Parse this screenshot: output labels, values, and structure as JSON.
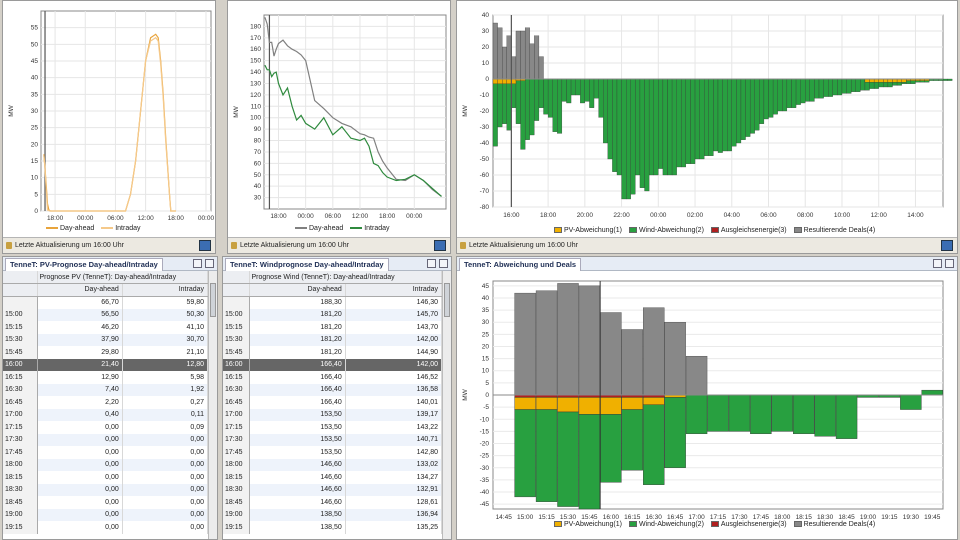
{
  "footer_text": "Letzte Aktualisierung um 16:00 Uhr",
  "colors": {
    "dayahead": "#e8a43c",
    "intraday": "#f5c98a",
    "wind_dayahead": "#808080",
    "wind_intraday": "#2f8a3e",
    "pv_dev": "#f0b000",
    "wind_dev": "#28a040",
    "balance": "#b02020",
    "deals": "#888888",
    "selection": "#666666"
  },
  "pv_chart": {
    "legend": [
      "Day-ahead",
      "Intraday"
    ],
    "chart_data": {
      "type": "line",
      "ylabel": "MW",
      "ylim": [
        0,
        60
      ],
      "yticks": [
        0,
        5,
        10,
        15,
        20,
        25,
        30,
        35,
        40,
        45,
        50,
        55
      ],
      "xticks": [
        "18:00",
        "00:00",
        "06:00",
        "12:00",
        "18:00",
        "00:00"
      ],
      "series": [
        {
          "name": "Day-ahead",
          "x": [
            15.75,
            16,
            16.25,
            16.5,
            16.75,
            17,
            17.25,
            17.5,
            18,
            24,
            30,
            32,
            33,
            34,
            35,
            36,
            37,
            38,
            38.5,
            39,
            39.5,
            40,
            40.75,
            41,
            41.25,
            41.5,
            41.75,
            42
          ],
          "values": [
            17,
            12.9,
            7.4,
            2.2,
            0.4,
            0,
            0,
            0,
            0,
            0,
            0,
            0,
            5,
            15,
            30,
            45,
            52,
            53,
            52,
            45,
            35,
            22,
            5,
            0,
            0,
            0,
            0,
            0
          ]
        },
        {
          "name": "Intraday",
          "x": [
            15.75,
            16,
            16.25,
            16.5,
            16.75,
            17,
            17.25,
            17.5,
            18,
            24,
            30,
            32,
            33,
            34,
            35,
            36,
            37,
            38,
            38.5,
            39,
            39.5,
            40,
            40.75,
            41,
            41.25,
            41.5,
            41.75,
            42
          ],
          "values": [
            17,
            12.8,
            5.98,
            0.27,
            0.11,
            0.09,
            0,
            0,
            0,
            0,
            0,
            0,
            5,
            15,
            30,
            45,
            51,
            52,
            51,
            44,
            34,
            21,
            5,
            0,
            0,
            0,
            0,
            0
          ]
        }
      ]
    }
  },
  "wind_chart": {
    "legend": [
      "Day-ahead",
      "Intraday"
    ],
    "chart_data": {
      "type": "line",
      "ylabel": "MW",
      "ylim": [
        20,
        190
      ],
      "yticks": [
        30,
        40,
        50,
        60,
        70,
        80,
        90,
        100,
        110,
        120,
        130,
        140,
        150,
        160,
        170,
        180
      ],
      "xticks": [
        "18:00",
        "00:00",
        "06:00",
        "12:00",
        "18:00",
        "00:00"
      ],
      "series": [
        {
          "name": "Day-ahead",
          "x": [
            15,
            15.5,
            16,
            16.5,
            17,
            17.5,
            18,
            19,
            20,
            21,
            22,
            23,
            24,
            26,
            28,
            30,
            32,
            34,
            36,
            37,
            38,
            39,
            40,
            41,
            42,
            44,
            46,
            48,
            50,
            52,
            54
          ],
          "values": [
            188,
            182,
            166,
            166,
            154,
            160,
            165,
            168,
            163,
            160,
            158,
            155,
            150,
            115,
            108,
            100,
            95,
            92,
            86,
            85,
            83,
            82,
            70,
            62,
            56,
            46,
            45,
            50,
            45,
            37,
            31
          ]
        },
        {
          "name": "Intraday",
          "x": [
            15,
            15.5,
            16,
            16.5,
            17,
            17.5,
            18,
            19,
            20,
            21,
            22,
            23,
            24,
            26,
            28,
            30,
            32,
            34,
            36,
            37,
            38,
            39,
            40,
            41,
            42,
            44,
            46,
            48,
            50,
            52,
            54
          ],
          "values": [
            146,
            142,
            142,
            136,
            139,
            140,
            130,
            120,
            126,
            110,
            98,
            102,
            95,
            90,
            100,
            85,
            92,
            82,
            80,
            82,
            75,
            60,
            58,
            52,
            48,
            45,
            46,
            50,
            45,
            38,
            31
          ]
        }
      ]
    }
  },
  "top_right_chart": {
    "legend": [
      "PV-Abweichung(1)",
      "Wind-Abweichung(2)",
      "Ausgleichsenergie(3)",
      "Resultierende Deals(4)"
    ],
    "chart_data": {
      "type": "bar",
      "ylabel": "MW",
      "ylim": [
        -80,
        40
      ],
      "yticks": [
        40,
        30,
        20,
        10,
        0,
        -10,
        -20,
        -30,
        -40,
        -50,
        -60,
        -70,
        -80
      ],
      "xticks": [
        "16:00",
        "18:00",
        "20:00",
        "22:00",
        "00:00",
        "02:00",
        "04:00",
        "06:00",
        "08:00",
        "10:00",
        "12:00",
        "14:00"
      ],
      "x_start_hours": 15.0,
      "x_step_hours": 0.25,
      "series": [
        {
          "name": "Resultierende Deals(4)",
          "values": [
            35,
            32,
            20,
            27,
            14,
            30,
            30,
            32,
            22,
            27,
            14,
            0
          ]
        },
        {
          "name": "Wind-Abweichung(2)",
          "values": [
            -42,
            -30,
            -28,
            -32,
            -18,
            -28,
            -44,
            -38,
            -35,
            -26,
            -18,
            -22,
            -24,
            -33,
            -34,
            -14,
            -15,
            -10,
            -10,
            -15,
            -14,
            -18,
            -12,
            -24,
            -40,
            -50,
            -58,
            -60,
            -75,
            -75,
            -72,
            -60,
            -68,
            -70,
            -60,
            -60,
            -56,
            -60,
            -60,
            -60,
            -55,
            -55,
            -53,
            -53,
            -50,
            -50,
            -48,
            -48,
            -45,
            -46,
            -45,
            -45,
            -42,
            -40,
            -38,
            -36,
            -34,
            -32,
            -28,
            -25,
            -24,
            -22,
            -20,
            -20,
            -18,
            -18,
            -16,
            -15,
            -14,
            -14,
            -12,
            -12,
            -11,
            -11,
            -10,
            -10,
            -9,
            -9,
            -8,
            -8,
            -7,
            -7,
            -6,
            -6,
            -5,
            -5,
            -5,
            -4,
            -4,
            -3,
            -3,
            -3,
            -2,
            -2,
            -2,
            -1,
            -1,
            -1,
            -1,
            -1,
            0,
            0,
            0
          ]
        },
        {
          "name": "PV-Abweichung(1)",
          "values": [
            -3,
            -3,
            -3,
            -3,
            -3,
            -1,
            -1,
            0,
            0,
            0,
            0,
            0,
            0,
            0,
            0,
            0,
            0,
            0,
            0,
            0,
            0,
            0,
            0,
            0,
            0,
            0,
            0,
            0,
            0,
            0,
            0,
            0,
            0,
            0,
            0,
            0,
            0,
            0,
            0,
            0,
            0,
            0,
            0,
            0,
            0,
            0,
            0,
            0,
            0,
            0,
            0,
            0,
            0,
            0,
            0,
            0,
            0,
            0,
            0,
            0,
            0,
            0,
            0,
            0,
            0,
            0,
            0,
            0,
            0,
            0,
            0,
            0,
            0,
            0,
            0,
            0,
            0,
            0,
            0,
            0,
            0,
            -2,
            -2,
            -2,
            -2,
            -2,
            -2,
            -2,
            -2,
            -2,
            -1,
            -1,
            -1,
            -1,
            -1,
            0,
            0,
            0,
            0,
            0,
            0,
            0,
            0
          ]
        }
      ]
    }
  },
  "pv_table": {
    "tab": "TenneT: PV-Prognose Day-ahead/Intraday",
    "group_header": "Prognose PV (TenneT): Day-ahead/Intraday",
    "columns": [
      "Day-ahead",
      "Intraday"
    ],
    "rows": [
      {
        "time": "",
        "da": "66,70",
        "id": "59,80"
      },
      {
        "time": "15:00",
        "da": "56,50",
        "id": "50,30"
      },
      {
        "time": "15:15",
        "da": "46,20",
        "id": "41,10"
      },
      {
        "time": "15:30",
        "da": "37,90",
        "id": "30,70"
      },
      {
        "time": "15:45",
        "da": "29,80",
        "id": "21,10"
      },
      {
        "time": "16:00",
        "da": "21,40",
        "id": "12,80"
      },
      {
        "time": "16:15",
        "da": "12,90",
        "id": "5,98"
      },
      {
        "time": "16:30",
        "da": "7,40",
        "id": "1,92"
      },
      {
        "time": "16:45",
        "da": "2,20",
        "id": "0,27"
      },
      {
        "time": "17:00",
        "da": "0,40",
        "id": "0,11"
      },
      {
        "time": "17:15",
        "da": "0,00",
        "id": "0,09"
      },
      {
        "time": "17:30",
        "da": "0,00",
        "id": "0,00"
      },
      {
        "time": "17:45",
        "da": "0,00",
        "id": "0,00"
      },
      {
        "time": "18:00",
        "da": "0,00",
        "id": "0,00"
      },
      {
        "time": "18:15",
        "da": "0,00",
        "id": "0,00"
      },
      {
        "time": "18:30",
        "da": "0,00",
        "id": "0,00"
      },
      {
        "time": "18:45",
        "da": "0,00",
        "id": "0,00"
      },
      {
        "time": "19:00",
        "da": "0,00",
        "id": "0,00"
      },
      {
        "time": "19:15",
        "da": "0,00",
        "id": "0,00"
      }
    ]
  },
  "wind_table": {
    "tab": "TenneT: Windprognose Day-ahead/Intraday",
    "group_header": "Prognose Wind (TenneT): Day-ahead/Intraday",
    "columns": [
      "Day-ahead",
      "Intraday"
    ],
    "rows": [
      {
        "time": "",
        "da": "188,30",
        "id": "146,30"
      },
      {
        "time": "15:00",
        "da": "181,20",
        "id": "145,70"
      },
      {
        "time": "15:15",
        "da": "181,20",
        "id": "143,70"
      },
      {
        "time": "15:30",
        "da": "181,20",
        "id": "142,00"
      },
      {
        "time": "15:45",
        "da": "181,20",
        "id": "144,90"
      },
      {
        "time": "16:00",
        "da": "166,40",
        "id": "142,00"
      },
      {
        "time": "16:15",
        "da": "166,40",
        "id": "146,52"
      },
      {
        "time": "16:30",
        "da": "166,40",
        "id": "136,58"
      },
      {
        "time": "16:45",
        "da": "166,40",
        "id": "140,01"
      },
      {
        "time": "17:00",
        "da": "153,50",
        "id": "139,17"
      },
      {
        "time": "17:15",
        "da": "153,50",
        "id": "143,22"
      },
      {
        "time": "17:30",
        "da": "153,50",
        "id": "140,71"
      },
      {
        "time": "17:45",
        "da": "153,50",
        "id": "142,80"
      },
      {
        "time": "18:00",
        "da": "146,60",
        "id": "133,02"
      },
      {
        "time": "18:15",
        "da": "146,60",
        "id": "134,27"
      },
      {
        "time": "18:30",
        "da": "146,60",
        "id": "132,91"
      },
      {
        "time": "18:45",
        "da": "146,60",
        "id": "128,61"
      },
      {
        "time": "19:00",
        "da": "138,50",
        "id": "136,94"
      },
      {
        "time": "19:15",
        "da": "138,50",
        "id": "135,25"
      }
    ]
  },
  "deals_chart": {
    "tab": "TenneT: Abweichung und Deals",
    "legend": [
      "PV-Abweichung(1)",
      "Wind-Abweichung(2)",
      "Ausgleichsenergie(3)",
      "Resultierende Deals(4)"
    ],
    "chart_data": {
      "type": "bar",
      "ylabel": "MW",
      "ylim": [
        -47,
        47
      ],
      "yticks": [
        45,
        40,
        35,
        30,
        25,
        20,
        15,
        10,
        5,
        0,
        -5,
        -10,
        -15,
        -20,
        -25,
        -30,
        -35,
        -40,
        -45
      ],
      "categories": [
        "14:45",
        "15:00",
        "15:15",
        "15:30",
        "15:45",
        "16:00",
        "16:15",
        "16:30",
        "16:45",
        "17:00",
        "17:15",
        "17:30",
        "17:45",
        "18:00",
        "18:15",
        "18:30",
        "18:45",
        "19:00",
        "19:15",
        "19:30",
        "19:45"
      ],
      "series": [
        {
          "name": "Resultierende Deals(4)",
          "values": [
            0,
            42,
            43,
            46,
            45,
            34,
            27,
            36,
            30,
            16,
            0,
            0,
            0,
            0,
            0,
            0,
            0,
            0,
            0,
            0,
            0
          ]
        },
        {
          "name": "Ausgleichsenergie(3)",
          "values": [
            0,
            -1,
            -1,
            -1,
            -1,
            -1,
            -1,
            -1,
            0,
            0,
            0,
            0,
            0,
            0,
            0,
            0,
            0,
            0,
            0,
            0,
            0
          ]
        },
        {
          "name": "PV-Abweichung(1)",
          "values": [
            0,
            -5,
            -5,
            -6,
            -7,
            -7,
            -5,
            -3,
            -1,
            0,
            0,
            0,
            0,
            0,
            0,
            0,
            0,
            0,
            0,
            0,
            0
          ]
        },
        {
          "name": "Wind-Abweichung(2)",
          "values": [
            0,
            -36,
            -38,
            -39,
            -39,
            -28,
            -25,
            -33,
            -29,
            -16,
            -15,
            -15,
            -16,
            -15,
            -16,
            -17,
            -18,
            -1,
            -1,
            -6,
            2
          ]
        }
      ]
    }
  }
}
